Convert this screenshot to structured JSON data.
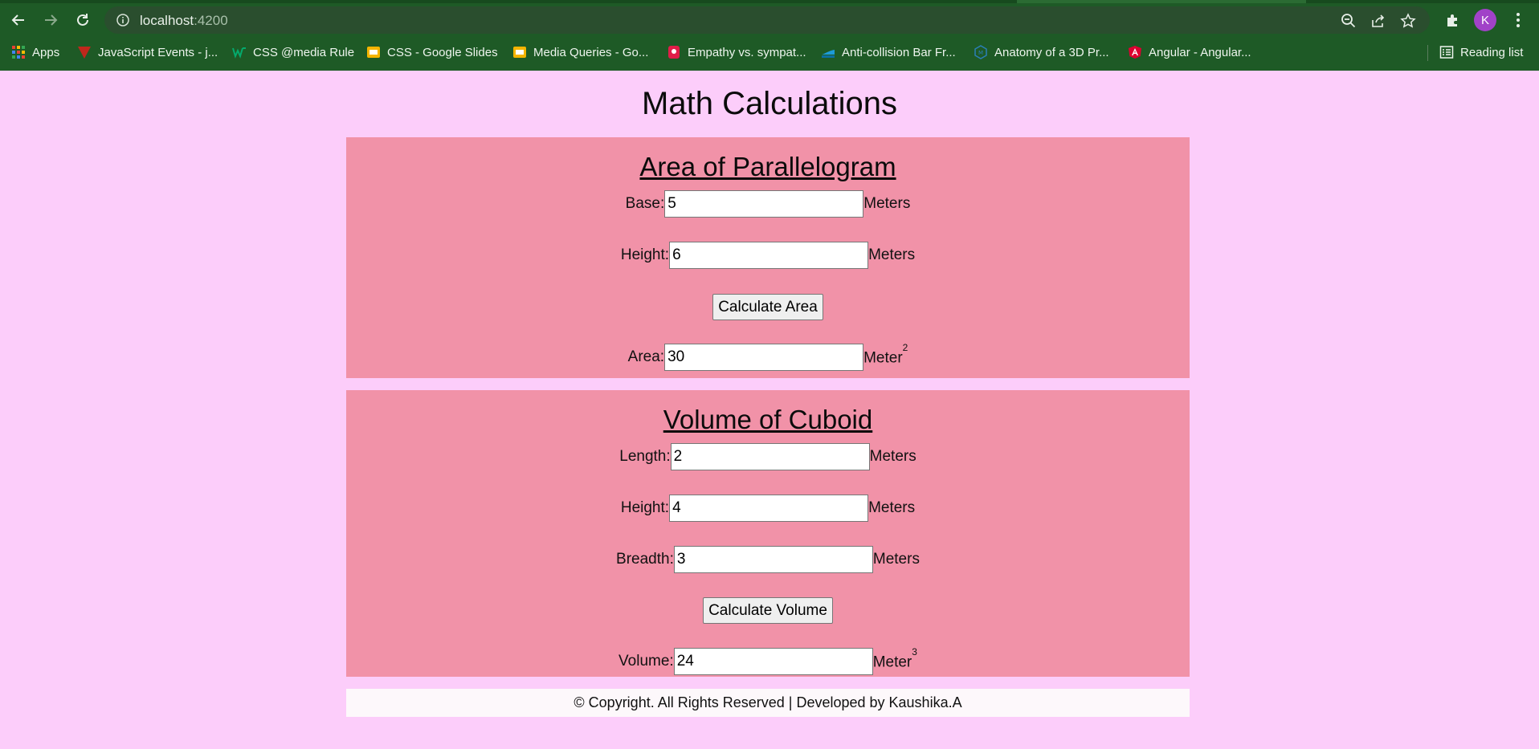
{
  "browser": {
    "url_host": "localhost",
    "url_port": ":4200",
    "profile_initial": "K",
    "bookmarks": [
      {
        "label": "Apps",
        "icon": "apps-grid-icon",
        "color": "#e94235"
      },
      {
        "label": "JavaScript Events - j...",
        "icon": "js-events-icon",
        "color": "#c0271c"
      },
      {
        "label": "CSS @media Rule",
        "icon": "w3schools-icon",
        "color": "#04aa6d"
      },
      {
        "label": "CSS - Google Slides",
        "icon": "slides-icon",
        "color": "#f4b400"
      },
      {
        "label": "Media Queries - Go...",
        "icon": "slides-icon",
        "color": "#f4b400"
      },
      {
        "label": "Empathy vs. sympat...",
        "icon": "empathy-icon",
        "color": "#e11d48"
      },
      {
        "label": "Anti-collision Bar Fr...",
        "icon": "anti-collision-icon",
        "color": "#1d9bd7"
      },
      {
        "label": "Anatomy of a 3D Pr...",
        "icon": "anatomy-icon",
        "color": "#2b7fb8"
      },
      {
        "label": "Angular - Angular...",
        "icon": "angular-icon",
        "color": "#dd0031"
      }
    ],
    "reading_list": "Reading list"
  },
  "page": {
    "title": "Math Calculations"
  },
  "area_section": {
    "title": "Area of Parallelogram",
    "base_label": "Base:",
    "base_value": "5",
    "base_unit": "Meters",
    "height_label": "Height:",
    "height_value": "6",
    "height_unit": "Meters",
    "button_label": "Calculate Area",
    "result_label": "Area:",
    "result_value": "30",
    "result_unit": "Meter",
    "result_exp": "2"
  },
  "volume_section": {
    "title": "Volume of Cuboid",
    "length_label": "Length:",
    "length_value": "2",
    "length_unit": "Meters",
    "height_label": "Height:",
    "height_value": "4",
    "height_unit": "Meters",
    "breadth_label": "Breadth:",
    "breadth_value": "3",
    "breadth_unit": "Meters",
    "button_label": "Calculate Volume",
    "result_label": "Volume:",
    "result_value": "24",
    "result_unit": "Meter",
    "result_exp": "3"
  },
  "footer": {
    "text": "© Copyright. All Rights Reserved | Developed by Kaushika.A"
  },
  "colors": {
    "chrome": "#1e5a26",
    "page_bg": "#fccdfa",
    "panel_bg": "#f192a8",
    "footer_bg": "#fdf8fb"
  }
}
